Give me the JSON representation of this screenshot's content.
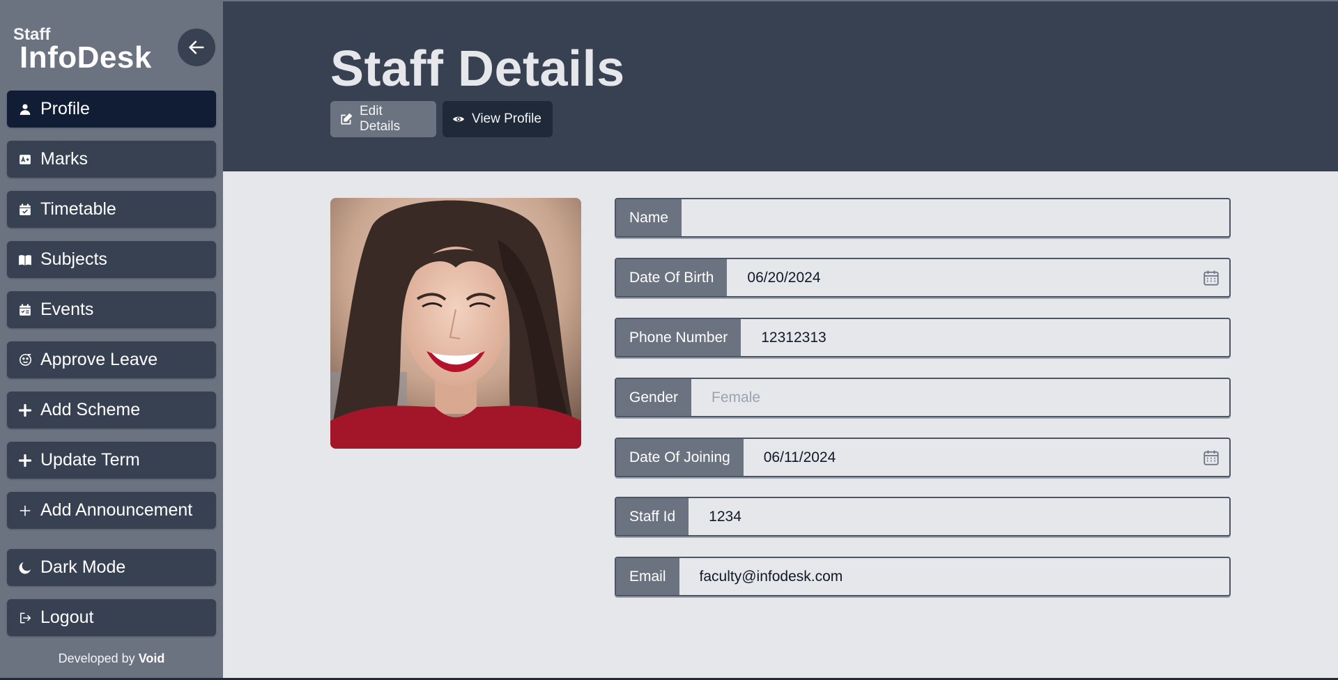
{
  "sidebar": {
    "brand_small": "Staff",
    "brand_big": "InfoDesk",
    "items": [
      {
        "label": "Profile",
        "icon": "person-icon",
        "active": true
      },
      {
        "label": "Marks",
        "icon": "marks-icon"
      },
      {
        "label": "Timetable",
        "icon": "calendar-check-icon"
      },
      {
        "label": "Subjects",
        "icon": "book-icon"
      },
      {
        "label": "Events",
        "icon": "calendar-event-icon"
      },
      {
        "label": "Approve Leave",
        "icon": "leave-icon"
      },
      {
        "label": "Add Scheme",
        "icon": "plus-icon"
      },
      {
        "label": "Update Term",
        "icon": "plus-icon"
      },
      {
        "label": "Add Announcement",
        "icon": "plus-thin-icon"
      },
      {
        "label": "Dark Mode",
        "icon": "moon-icon"
      },
      {
        "label": "Logout",
        "icon": "logout-icon"
      }
    ],
    "footer_prefix": "Developed by",
    "footer_name": "Void"
  },
  "header": {
    "title": "Staff Details",
    "edit_label": "Edit Details",
    "view_label": "View Profile"
  },
  "form": {
    "name": {
      "label": "Name",
      "value": ""
    },
    "dob": {
      "label": "Date Of Birth",
      "value": "06/20/2024"
    },
    "phone": {
      "label": "Phone Number",
      "value": "12312313"
    },
    "gender": {
      "label": "Gender",
      "value": "",
      "placeholder": "Female"
    },
    "doj": {
      "label": "Date Of Joining",
      "value": "06/11/2024"
    },
    "staff_id": {
      "label": "Staff Id",
      "value": "1234"
    },
    "email": {
      "label": "Email",
      "value": "faculty@infodesk.com"
    }
  },
  "colors": {
    "sidebar_bg": "#6b7280",
    "nav_item_bg": "#374151",
    "nav_active_bg": "#111c35",
    "header_bg": "#374151",
    "content_bg": "#e5e7eb"
  }
}
